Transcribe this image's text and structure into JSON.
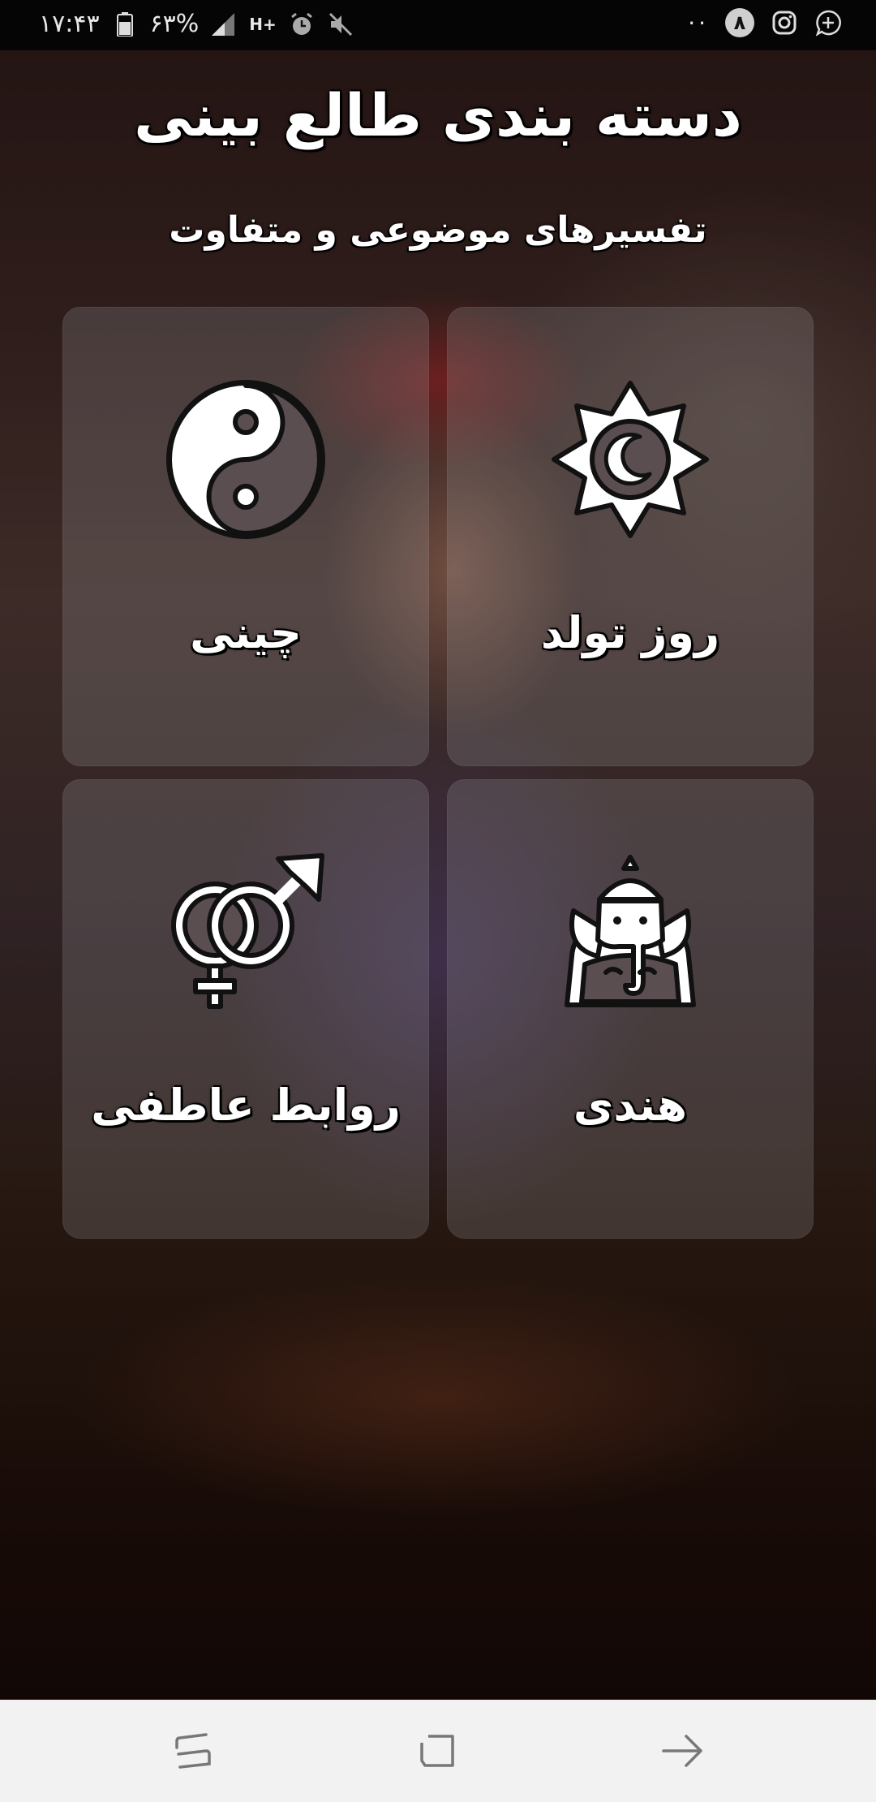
{
  "status_bar": {
    "time": "۱۷:۴۳",
    "battery_percent": "۶۳%",
    "network_label": "H+",
    "notification_count": "۸",
    "more_dots": "··"
  },
  "header": {
    "title": "دسته بندی طالع بینی",
    "subtitle": "تفسیرهای موضوعی و متفاوت"
  },
  "categories": [
    {
      "label": "روز تولد",
      "icon": "sun-moon-icon"
    },
    {
      "label": "چینی",
      "icon": "yin-yang-icon"
    },
    {
      "label": "هندی",
      "icon": "ganesha-icon"
    },
    {
      "label": "روابط عاطفی",
      "icon": "gender-symbols-icon"
    }
  ],
  "navbar": {
    "buttons": [
      "recent-apps",
      "home",
      "back"
    ]
  },
  "colors": {
    "card_overlay": "#aaaaaf",
    "icon_fill": "#5a4e50",
    "text": "#ffffff",
    "status_bar": "#050505",
    "nav_bar": "#f2f2f2"
  }
}
